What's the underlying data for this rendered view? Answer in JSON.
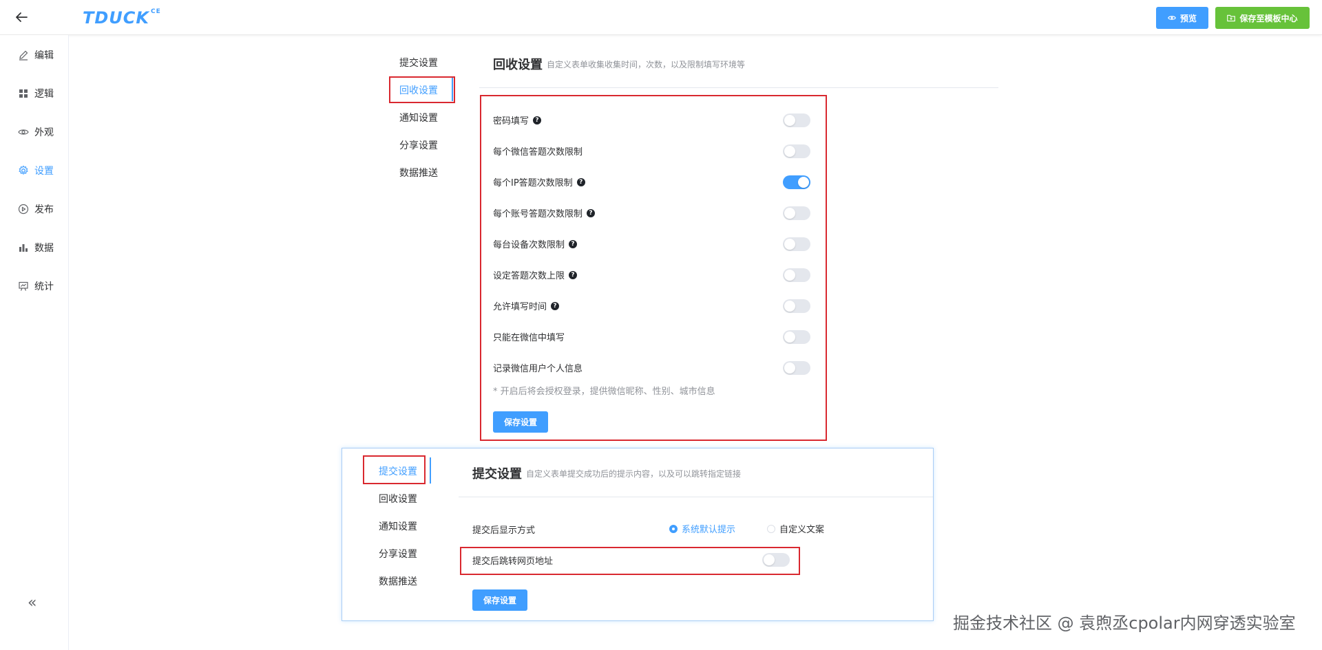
{
  "header": {
    "logo_text": "TDUCK",
    "logo_sup": "CE",
    "preview_label": "预览",
    "save_template_label": "保存至模板中心"
  },
  "sidebar": {
    "items": [
      {
        "label": "编辑",
        "icon": "pencil-icon"
      },
      {
        "label": "逻辑",
        "icon": "grid-icon"
      },
      {
        "label": "外观",
        "icon": "eye-icon"
      },
      {
        "label": "设置",
        "icon": "gear-icon"
      },
      {
        "label": "发布",
        "icon": "play-circle-icon"
      },
      {
        "label": "数据",
        "icon": "bar-chart-icon"
      },
      {
        "label": "统计",
        "icon": "presentation-icon"
      }
    ],
    "active": "设置",
    "collapse_glyph": "«"
  },
  "settings_nav": {
    "items": [
      "提交设置",
      "回收设置",
      "通知设置",
      "分享设置",
      "数据推送"
    ],
    "active": "回收设置"
  },
  "recycle_section": {
    "title": "回收设置",
    "description": "自定义表单收集收集时间，次数，以及限制填写环境等",
    "rows": [
      {
        "label": "密码填写",
        "help": true,
        "enabled": false
      },
      {
        "label": "每个微信答题次数限制",
        "help": false,
        "enabled": false
      },
      {
        "label": "每个IP答题次数限制",
        "help": true,
        "enabled": true
      },
      {
        "label": "每个账号答题次数限制",
        "help": true,
        "enabled": false
      },
      {
        "label": "每台设备次数限制",
        "help": true,
        "enabled": false
      },
      {
        "label": "设定答题次数上限",
        "help": true,
        "enabled": false
      },
      {
        "label": "允许填写时间",
        "help": true,
        "enabled": false
      },
      {
        "label": "只能在微信中填写",
        "help": false,
        "enabled": false
      },
      {
        "label": "记录微信用户个人信息",
        "help": false,
        "enabled": false
      }
    ],
    "note": "* 开启后将会授权登录，提供微信昵称、性别、城市信息",
    "save_label": "保存设置"
  },
  "submit_panel": {
    "nav_items": [
      "提交设置",
      "回收设置",
      "通知设置",
      "分享设置",
      "数据推送"
    ],
    "active": "提交设置",
    "title": "提交设置",
    "description": "自定义表单提交成功后的提示内容，以及可以跳转指定链接",
    "display_mode_label": "提交后显示方式",
    "options": [
      {
        "label": "系统默认提示",
        "checked": true
      },
      {
        "label": "自定义文案",
        "checked": false
      }
    ],
    "redirect_label": "提交后跳转网页地址",
    "redirect_enabled": false,
    "save_label": "保存设置"
  },
  "watermark": "掘金技术社区 @ 袁煦丞cpolar内网穿透实验室",
  "colors": {
    "primary": "#409eff",
    "success": "#67c23a",
    "highlight_box": "#d9282f"
  }
}
